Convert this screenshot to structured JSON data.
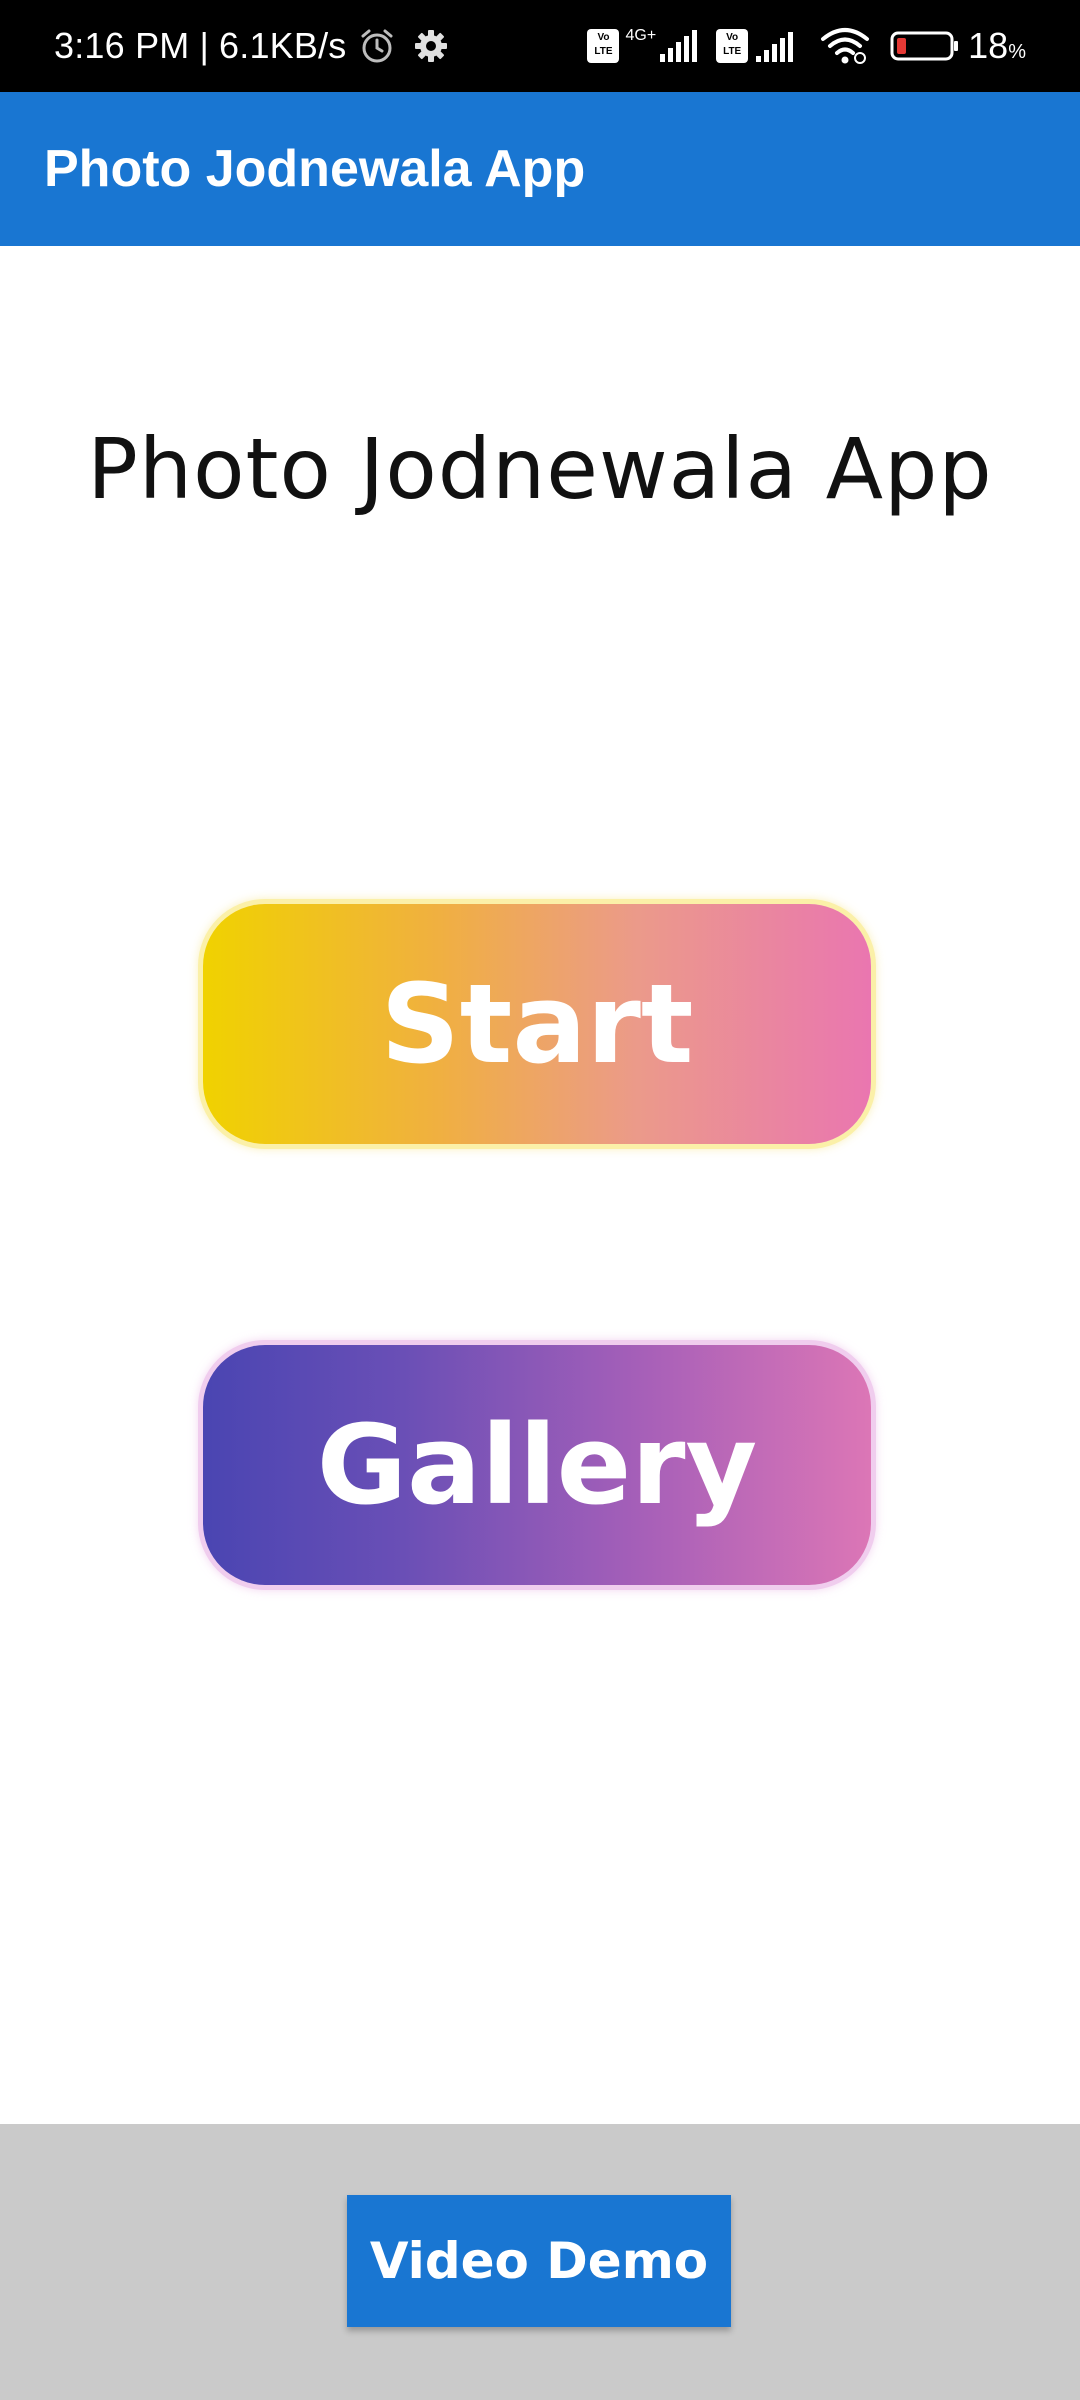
{
  "status_bar": {
    "time": "3:16 PM",
    "separator": "|",
    "network_speed": "6.1KB/s",
    "alarm_icon": "alarm-icon",
    "settings_icon": "gear-icon",
    "volte_1": "Vo LTE",
    "network_type": "4G+",
    "volte_2": "Vo LTE",
    "battery_percent": "18",
    "battery_unit": "%",
    "battery_color": "#e53935"
  },
  "app_bar": {
    "title": "Photo Jodnewala App",
    "color": "#1976d2"
  },
  "main": {
    "heading": "Photo Jodnewala App",
    "start_label": "Start",
    "gallery_label": "Gallery"
  },
  "bottom_bar": {
    "video_demo_label": "Video Demo",
    "background": "#cacaca"
  }
}
